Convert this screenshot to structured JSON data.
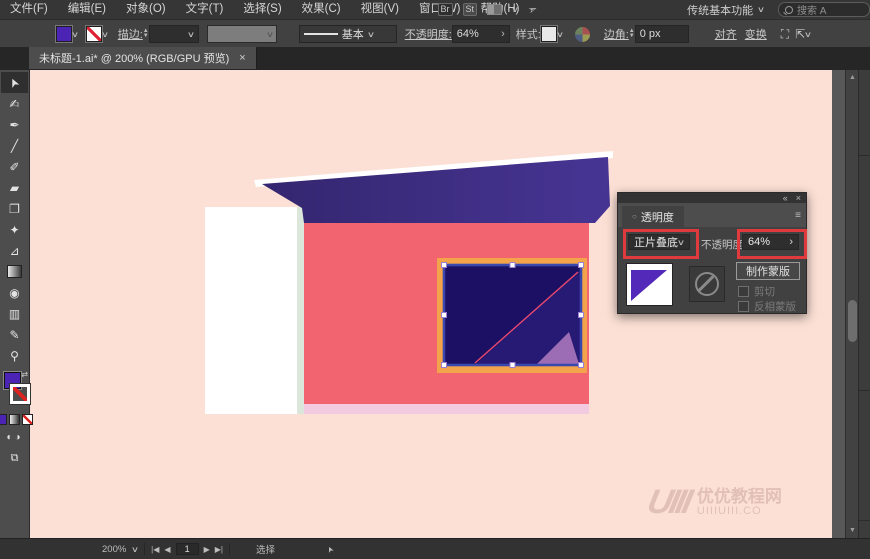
{
  "menu": {
    "items": [
      {
        "label": "文件(F)"
      },
      {
        "label": "编辑(E)"
      },
      {
        "label": "对象(O)"
      },
      {
        "label": "文字(T)"
      },
      {
        "label": "选择(S)"
      },
      {
        "label": "效果(C)"
      },
      {
        "label": "视图(V)"
      },
      {
        "label": "窗口(W)"
      },
      {
        "label": "帮助(H)"
      }
    ],
    "right": {
      "bridge": "Br",
      "stock": "St",
      "workspace": "传统基本功能",
      "search_placeholder": "搜索 A"
    }
  },
  "control_bar": {
    "stroke_label": "描边:",
    "line_style": "基本",
    "opacity_label": "不透明度:",
    "opacity_value": "64%",
    "style_label": "样式:",
    "corner_label": "边角:",
    "corner_value": "0 px",
    "align_label": "对齐",
    "transform_label": "变换",
    "fill_color": "#4B23B5"
  },
  "document_tab": {
    "title": "未标题-1.ai* @ 200% (RGB/GPU 预览)",
    "close": "×"
  },
  "toolbar_tools": [
    {
      "name": "selection-tool",
      "glyph": "➤",
      "active": true
    },
    {
      "name": "curvature-tool",
      "glyph": "✍",
      "active": false
    },
    {
      "name": "pen-tool",
      "glyph": "✒",
      "active": false
    },
    {
      "name": "line-segment-tool",
      "glyph": "╱",
      "active": false
    },
    {
      "name": "paintbrush-tool",
      "glyph": "✐",
      "active": false
    },
    {
      "name": "eraser-tool",
      "glyph": "▰",
      "active": false
    },
    {
      "name": "scale-tool",
      "glyph": "❐",
      "active": false
    },
    {
      "name": "puppet-warp-tool",
      "glyph": "✦",
      "active": false
    },
    {
      "name": "perspective-grid-tool",
      "glyph": "⊿",
      "active": false
    },
    {
      "name": "gradient-tool",
      "glyph": "",
      "active": false
    },
    {
      "name": "symbol-sprayer-tool",
      "glyph": "◉",
      "active": false
    },
    {
      "name": "column-graph-tool",
      "glyph": "▥",
      "active": false
    },
    {
      "name": "pencil-tool",
      "glyph": "✎",
      "active": false
    },
    {
      "name": "zoom-tool",
      "glyph": "⚲",
      "active": false
    }
  ],
  "transparency_panel": {
    "collapse": "«",
    "close": "×",
    "menu_icon": "≡",
    "title": "透明度",
    "blend_mode": "正片叠底",
    "opacity_label": "不透明度 :",
    "opacity_value": "64%",
    "opacity_arrow": "›",
    "make_mask_label": "制作蒙版",
    "clip_label": "剪切",
    "invert_mask_label": "反相蒙版",
    "highlight_color": "#E13A3E"
  },
  "artwork": {
    "colors": {
      "artboard": "#FCE0D5",
      "wall": "#F2646F",
      "roof_left": "#34266F",
      "roof_right": "#473594",
      "roof_highlight": "#FFFFFF",
      "column": "#FFFFFF",
      "column_edge": "#DCE7DB",
      "base_strip": "#F3CBE1",
      "window_frame": "#F3A44B",
      "window_dark": "#1C1065",
      "window_mid": "#271A74",
      "window_light_triangle": "#9C6DB5",
      "diagonal_line": "#E9486E",
      "selection_stroke": "#3A47AC",
      "thumb_triangle": "#5229B8"
    }
  },
  "watermark": {
    "logo": "UIII",
    "title": "优优教程网",
    "site": "UIIIUIII.CO"
  },
  "status_bar": {
    "zoom": "200%",
    "first": "|◀",
    "prev": "◀",
    "page": "1",
    "next": "▶",
    "last": "▶|",
    "tool_name": "选择",
    "cursor": "➤"
  }
}
